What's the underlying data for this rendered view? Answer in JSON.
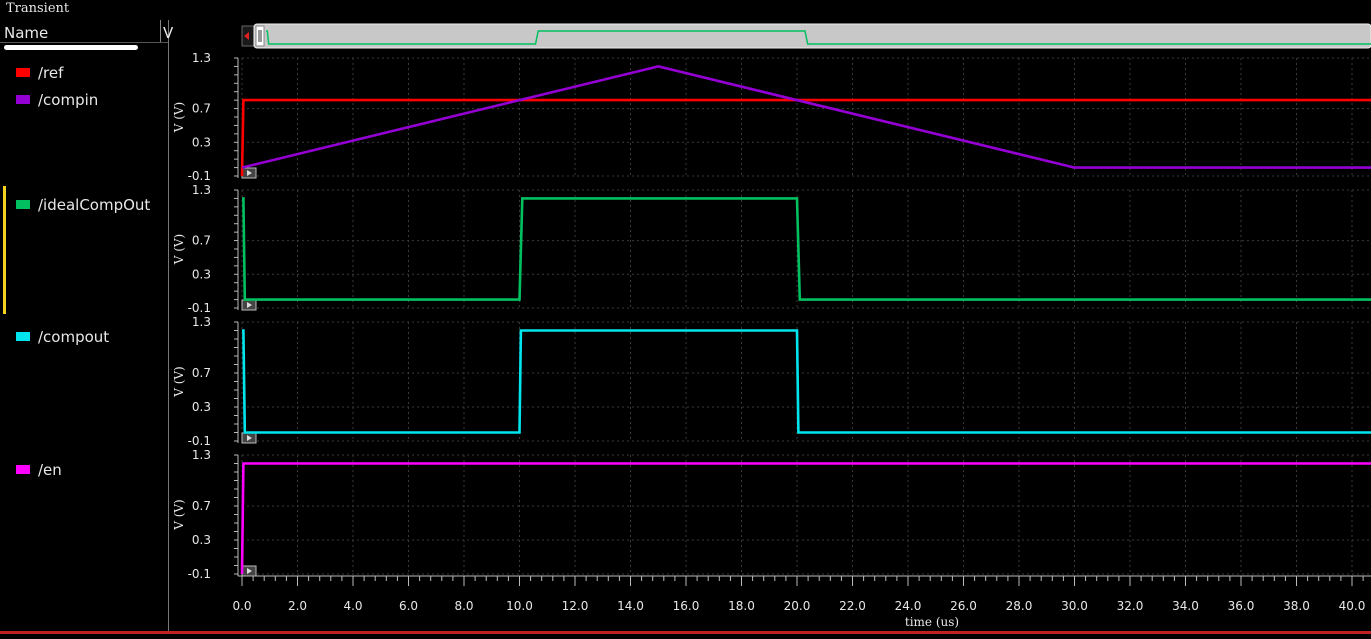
{
  "window": {
    "title": "Transient"
  },
  "legend": {
    "name_header": "Name",
    "value_header": "V"
  },
  "signals": [
    {
      "name": "/ref",
      "color": "#ff0000"
    },
    {
      "name": "/compin",
      "color": "#9400d3"
    },
    {
      "name": "/idealCompOut",
      "color": "#00c060"
    },
    {
      "name": "/compout",
      "color": "#00e5ee"
    },
    {
      "name": "/en",
      "color": "#ff00ff"
    }
  ],
  "chart_data": {
    "type": "line",
    "xlabel": "time (us)",
    "x_ticks": [
      "0.0",
      "2.0",
      "4.0",
      "6.0",
      "8.0",
      "10.0",
      "12.0",
      "14.0",
      "16.0",
      "18.0",
      "20.0",
      "22.0",
      "24.0",
      "26.0",
      "28.0",
      "30.0",
      "32.0",
      "34.0",
      "36.0",
      "38.0",
      "40.0"
    ],
    "xlim": [
      0,
      41
    ],
    "ylim": [
      -0.1,
      1.3
    ],
    "y_ticks": [
      "1.3",
      "0.7",
      "0.3",
      "-0.1"
    ],
    "ylabel": "V (V)",
    "grid": true,
    "strips": [
      {
        "series": [
          {
            "name": "/ref",
            "x": [
              0,
              0.05,
              41
            ],
            "y": [
              -0.1,
              0.8,
              0.8
            ]
          },
          {
            "name": "/compin",
            "x": [
              0,
              15,
              30,
              41
            ],
            "y": [
              0.0,
              1.2,
              0.0,
              0.0
            ]
          }
        ]
      },
      {
        "series": [
          {
            "name": "/idealCompOut",
            "x": [
              0,
              0.05,
              0.1,
              10.0,
              10.1,
              20.0,
              20.1,
              41
            ],
            "y": [
              1.2,
              1.2,
              0.0,
              0.0,
              1.2,
              1.2,
              0.0,
              0.0
            ]
          }
        ]
      },
      {
        "series": [
          {
            "name": "/compout",
            "x": [
              0,
              0.05,
              0.1,
              10.0,
              10.05,
              20.0,
              20.05,
              41
            ],
            "y": [
              1.2,
              1.2,
              0.0,
              0.0,
              1.2,
              1.2,
              0.0,
              0.0
            ]
          }
        ]
      },
      {
        "series": [
          {
            "name": "/en",
            "x": [
              0,
              0.05,
              41
            ],
            "y": [
              -0.1,
              1.2,
              1.2
            ]
          }
        ]
      }
    ]
  },
  "overview": {
    "signal": "/idealCompOut",
    "color": "#00c060",
    "x": [
      0,
      0.05,
      0.1,
      10.0,
      10.1,
      20.0,
      20.1,
      41
    ],
    "y": [
      1.2,
      1.2,
      0.0,
      0.0,
      1.2,
      1.2,
      0.0,
      0.0
    ]
  }
}
